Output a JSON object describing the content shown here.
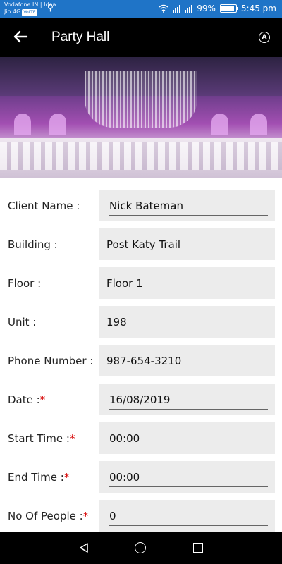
{
  "status_bar": {
    "carrier_line1": "Vodafone IN | Idea",
    "carrier_line2": "Jio 4G",
    "volte": "VoLTE",
    "battery": "99%",
    "time": "5:45 pm"
  },
  "app_bar": {
    "title": "Party Hall",
    "a_icon_label": "A"
  },
  "form": {
    "client_name": {
      "label": "Client Name :",
      "value": "Nick Bateman"
    },
    "building": {
      "label": "Building :",
      "value": "Post Katy Trail"
    },
    "floor": {
      "label": "Floor :",
      "value": "Floor 1"
    },
    "unit": {
      "label": "Unit :",
      "value": "198"
    },
    "phone": {
      "label": "Phone Number :",
      "value": "987-654-3210"
    },
    "date": {
      "label": "Date :",
      "value": "16/08/2019"
    },
    "start_time": {
      "label": "Start Time :",
      "value": "00:00"
    },
    "end_time": {
      "label": "End Time :",
      "value": "00:00"
    },
    "people": {
      "label": "No Of People :",
      "value": "0"
    },
    "required_mark": "*"
  },
  "colors": {
    "status_bar": "#1f74c7",
    "app_bar": "#000000",
    "field_bg": "#ececec",
    "required": "#d60000"
  },
  "icons": [
    "back-arrow-icon",
    "account-circle-a-icon",
    "wifi-icon",
    "signal-icon",
    "battery-icon",
    "usb-icon",
    "nav-back-icon",
    "nav-home-icon",
    "nav-recent-icon"
  ]
}
